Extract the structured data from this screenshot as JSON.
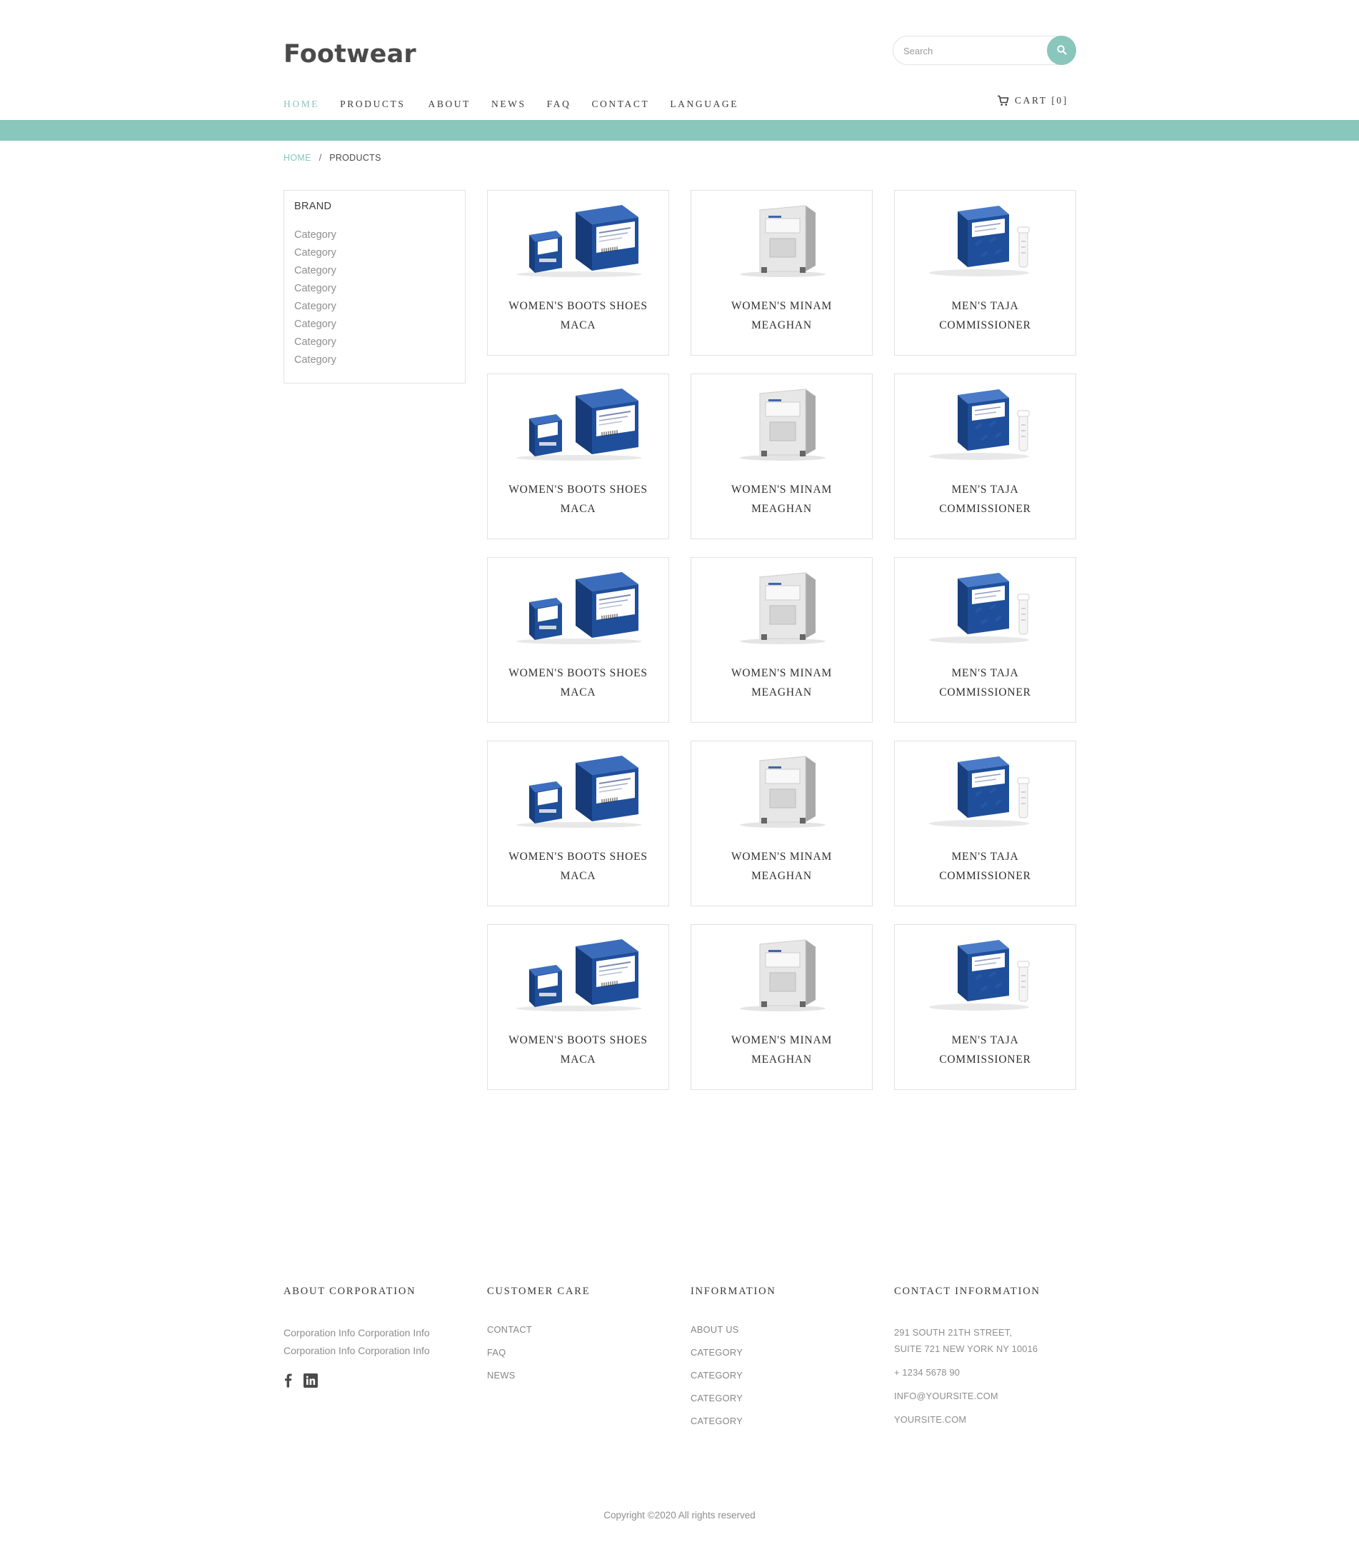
{
  "header": {
    "logo": "Footwear",
    "search_placeholder": "Search",
    "cart_label": "CART [0]"
  },
  "nav": [
    "HOME",
    "PRODUCTS",
    "ABOUT",
    "NEWS",
    "FAQ",
    "CONTACT",
    "LANGUAGE"
  ],
  "breadcrumb": {
    "home": "HOME",
    "separator": "/",
    "current": "PRODUCTS"
  },
  "sidebar": {
    "title": "BRAND",
    "categories": [
      "Category",
      "Category",
      "Category",
      "Category",
      "Category",
      "Category",
      "Category",
      "Category"
    ]
  },
  "products": [
    {
      "line1": "WOMEN'S BOOTS SHOES",
      "line2": "MACA",
      "image": "blue-kit-boxes"
    },
    {
      "line1": "WOMEN'S MINAM",
      "line2": "MEAGHAN",
      "image": "grey-instrument"
    },
    {
      "line1": "MEN'S TAJA",
      "line2": "COMMISSIONER",
      "image": "blue-box-with-tube"
    },
    {
      "line1": "WOMEN'S BOOTS SHOES",
      "line2": "MACA",
      "image": "blue-kit-boxes"
    },
    {
      "line1": "WOMEN'S MINAM",
      "line2": "MEAGHAN",
      "image": "grey-instrument"
    },
    {
      "line1": "MEN'S TAJA",
      "line2": "COMMISSIONER",
      "image": "blue-box-with-tube"
    },
    {
      "line1": "WOMEN'S BOOTS SHOES",
      "line2": "MACA",
      "image": "blue-kit-boxes"
    },
    {
      "line1": "WOMEN'S MINAM",
      "line2": "MEAGHAN",
      "image": "grey-instrument"
    },
    {
      "line1": "MEN'S TAJA",
      "line2": "COMMISSIONER",
      "image": "blue-box-with-tube"
    },
    {
      "line1": "WOMEN'S BOOTS SHOES",
      "line2": "MACA",
      "image": "blue-kit-boxes"
    },
    {
      "line1": "WOMEN'S MINAM",
      "line2": "MEAGHAN",
      "image": "grey-instrument"
    },
    {
      "line1": "MEN'S TAJA",
      "line2": "COMMISSIONER",
      "image": "blue-box-with-tube"
    },
    {
      "line1": "WOMEN'S BOOTS SHOES",
      "line2": "MACA",
      "image": "blue-kit-boxes"
    },
    {
      "line1": "WOMEN'S MINAM",
      "line2": "MEAGHAN",
      "image": "grey-instrument"
    },
    {
      "line1": "MEN'S TAJA",
      "line2": "COMMISSIONER",
      "image": "blue-box-with-tube"
    }
  ],
  "footer": {
    "about": {
      "title": "ABOUT CORPORATION",
      "text": "Corporation Info Corporation Info Corporation Info Corporation Info",
      "socials": [
        "facebook-icon",
        "linkedin-icon"
      ]
    },
    "customer_care": {
      "title": "CUSTOMER CARE",
      "links": [
        "CONTACT",
        "FAQ",
        "NEWS"
      ]
    },
    "information": {
      "title": "INFORMATION",
      "links": [
        "ABOUT US",
        "CATEGORY",
        "CATEGORY",
        "CATEGORY",
        "CATEGORY"
      ]
    },
    "contact": {
      "title": "CONTACT INFORMATION",
      "address_line1": "291 SOUTH 21TH STREET,",
      "address_line2": "SUITE 721 NEW YORK NY 10016",
      "phone": "+ 1234 5678 90",
      "email": "INFO@YOURSITE.COM",
      "website": "YOURSITE.COM"
    },
    "copyright": "Copyright ©2020 All rights reserved"
  },
  "colors": {
    "accent": "#89c6bb",
    "text_dark": "#3e3e3e",
    "text_muted": "#8e8e8e",
    "border": "#e2e2e2",
    "product_blue": "#1f4f9b"
  }
}
